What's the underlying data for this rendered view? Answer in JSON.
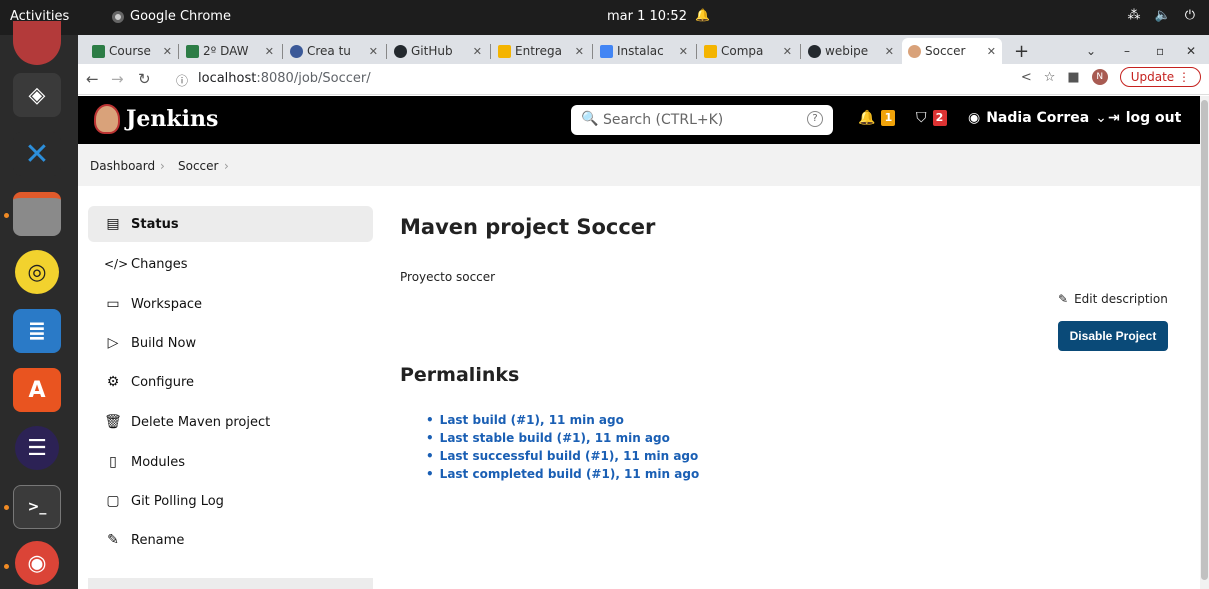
{
  "topbar": {
    "activities": "Activities",
    "app": "Google Chrome",
    "clock": "mar 1  10:52"
  },
  "tabs": [
    {
      "label": "Course",
      "color": "#2d7d46"
    },
    {
      "label": "2º DAW",
      "color": "#2d7d46"
    },
    {
      "label": "Crea tu",
      "color": "#3b5998"
    },
    {
      "label": "GitHub",
      "color": "#24292e"
    },
    {
      "label": "Entrega",
      "color": "#f4b400"
    },
    {
      "label": "Instalac",
      "color": "#4285f4"
    },
    {
      "label": "Compa",
      "color": "#f4b400"
    },
    {
      "label": "webipe",
      "color": "#24292e"
    },
    {
      "label": "Soccer",
      "color": "#d9a27a"
    }
  ],
  "address": {
    "host": "localhost",
    "path": ":8080/job/Soccer/",
    "update": "Update"
  },
  "header": {
    "title": "Jenkins",
    "search_placeholder": "Search (CTRL+K)",
    "notifications_count": "1",
    "security_count": "2",
    "user": "Nadia Correa",
    "logout": "log out"
  },
  "breadcrumb": {
    "dashboard": "Dashboard",
    "job": "Soccer"
  },
  "side": {
    "items": [
      {
        "label": "Status",
        "icon": "📄"
      },
      {
        "label": "Changes",
        "icon": "</>"
      },
      {
        "label": "Workspace",
        "icon": "🗀"
      },
      {
        "label": "Build Now",
        "icon": "▷"
      },
      {
        "label": "Configure",
        "icon": "⚙"
      },
      {
        "label": "Delete Maven project",
        "icon": "🗑"
      },
      {
        "label": "Modules",
        "icon": "📄"
      },
      {
        "label": "Git Polling Log",
        "icon": "📋"
      },
      {
        "label": "Rename",
        "icon": "✎"
      }
    ]
  },
  "main": {
    "title": "Maven project Soccer",
    "description": "Proyecto soccer",
    "edit_description": "Edit description",
    "disable_button": "Disable Project",
    "permalinks_title": "Permalinks",
    "permalinks": [
      "Last build (#1), 11 min ago",
      "Last stable build (#1), 11 min ago",
      "Last successful build (#1), 11 min ago",
      "Last completed build (#1), 11 min ago"
    ]
  }
}
